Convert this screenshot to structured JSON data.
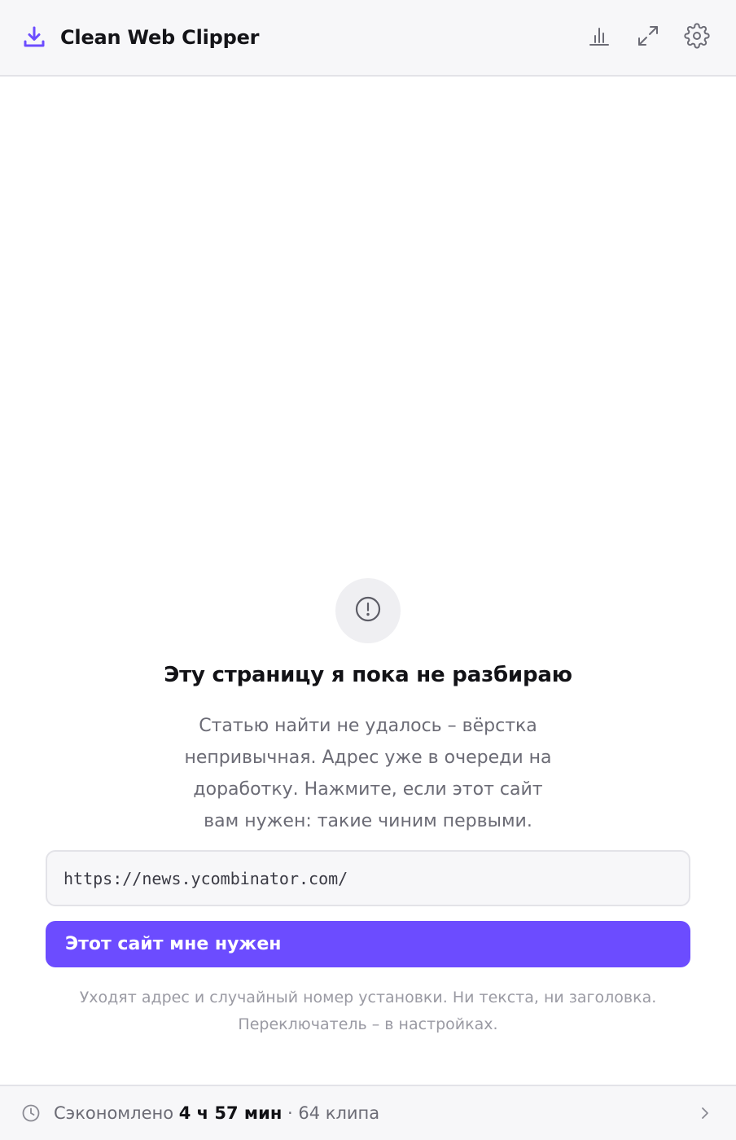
{
  "header": {
    "title": "Clean Web Clipper",
    "logo_icon": "download-tray-icon",
    "actions": [
      {
        "name": "stats",
        "icon": "bar-chart-icon"
      },
      {
        "name": "expand",
        "icon": "expand-icon"
      },
      {
        "name": "settings",
        "icon": "gear-icon"
      }
    ]
  },
  "main": {
    "status_icon": "alert-circle-icon",
    "headline": "Эту страницу я пока не разбираю",
    "description_lines": [
      "Статью найти не удалось – вёрстка",
      "непривычная. Адрес уже в очереди на",
      "доработку. Нажмите, если этот сайт",
      "вам нужен: такие чиним первыми."
    ],
    "url_value": "https://news.ycombinator.com/",
    "request_button_label": "Этот сайт мне нужен",
    "privacy_note_lines": [
      "Уходят адрес и случайный номер установки. Ни текста, ни заголовка.",
      "Переключатель – в настройках."
    ]
  },
  "footer": {
    "prefix": "Сэкономлено",
    "time_saved": "4 ч 57 мин",
    "separator": "·",
    "clips_count": "64 клипа"
  },
  "colors": {
    "accent": "#6c4cff",
    "header_bg": "#f7f7f9",
    "border": "#e3e3e8",
    "muted_text": "#6b6b75",
    "note_text": "#9a9aa3",
    "icon_gray": "#6b6b75"
  }
}
